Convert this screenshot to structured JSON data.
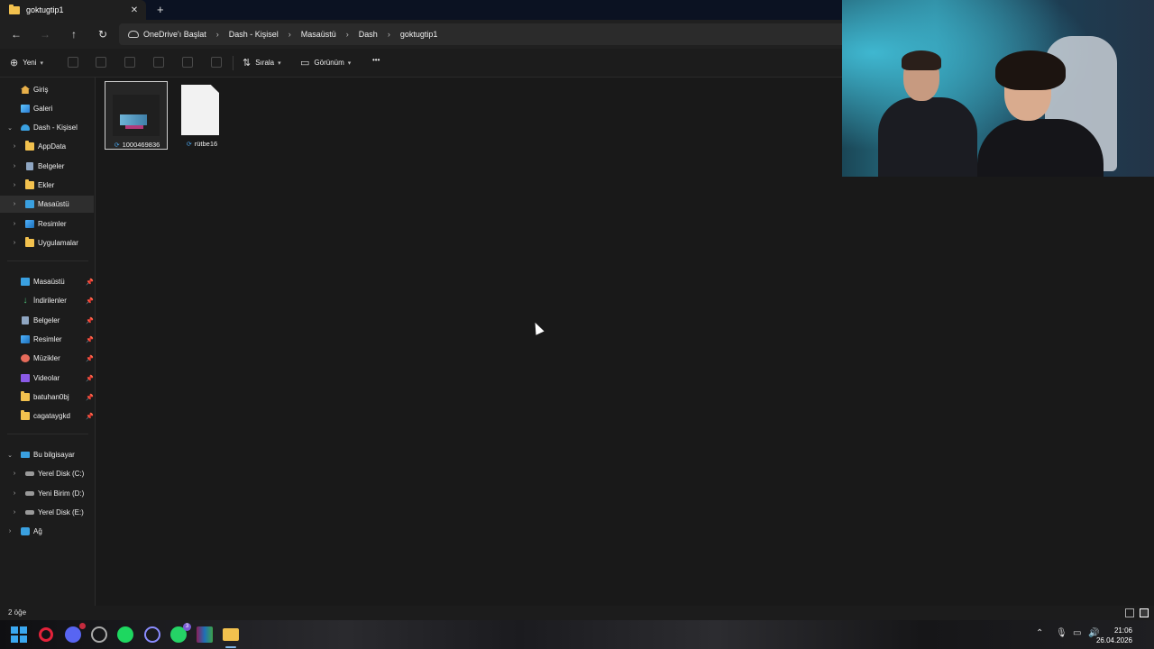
{
  "tab": {
    "title": "goktugtip1",
    "close_glyph": "✕",
    "new_glyph": "+"
  },
  "nav": {
    "back": "←",
    "forward": "→",
    "up": "↑",
    "refresh": "↻"
  },
  "breadcrumb": [
    "OneDrive'ı Başlat",
    "Dash - Kişisel",
    "Masaüstü",
    "Dash",
    "goktugtip1"
  ],
  "toolbar": {
    "new_label": "Yeni",
    "sort_label": "Sırala",
    "view_label": "Görünüm",
    "more_glyph": "•••"
  },
  "sidebar": {
    "top": [
      {
        "label": "Giriş",
        "icon": "home-icon"
      },
      {
        "label": "Galeri",
        "icon": "gallery-icon"
      }
    ],
    "onedrive": {
      "label": "Dash - Kişisel",
      "children": [
        {
          "label": "AppData",
          "icon": "folder-icon"
        },
        {
          "label": "Belgeler",
          "icon": "documents-icon"
        },
        {
          "label": "Ekler",
          "icon": "folder-icon"
        },
        {
          "label": "Masaüstü",
          "icon": "desktop-icon",
          "selected": true
        },
        {
          "label": "Resimler",
          "icon": "pictures-icon"
        },
        {
          "label": "Uygulamalar",
          "icon": "folder-icon"
        }
      ]
    },
    "quick_access": [
      {
        "label": "Masaüstü",
        "icon": "desktop-icon"
      },
      {
        "label": "İndirilenler",
        "icon": "download-icon"
      },
      {
        "label": "Belgeler",
        "icon": "documents-icon"
      },
      {
        "label": "Resimler",
        "icon": "pictures-icon"
      },
      {
        "label": "Müzikler",
        "icon": "music-icon"
      },
      {
        "label": "Videolar",
        "icon": "video-icon"
      },
      {
        "label": "batuhan0bj",
        "icon": "folder-icon"
      },
      {
        "label": "cagataygkd",
        "icon": "folder-icon"
      }
    ],
    "this_pc": {
      "label": "Bu bilgisayar",
      "children": [
        {
          "label": "Yerel Disk (C:)",
          "icon": "drive-icon"
        },
        {
          "label": "Yeni Birim (D:)",
          "icon": "drive-icon"
        },
        {
          "label": "Yerel Disk (E:)",
          "icon": "drive-icon"
        }
      ]
    },
    "network": {
      "label": "Ağ"
    }
  },
  "files": [
    {
      "name": "1000469836",
      "type": "image",
      "selected": true
    },
    {
      "name": "rütbe16",
      "type": "document",
      "selected": false
    }
  ],
  "status": {
    "item_count": "2 öğe"
  },
  "taskbar": {
    "discord_badge": "",
    "whatsapp_badge": "3",
    "clock_time": "21:06",
    "clock_date": "26.04.2026"
  },
  "colors": {
    "accent": "#3aa7f0",
    "folder": "#f2c14e",
    "background": "#191919"
  }
}
